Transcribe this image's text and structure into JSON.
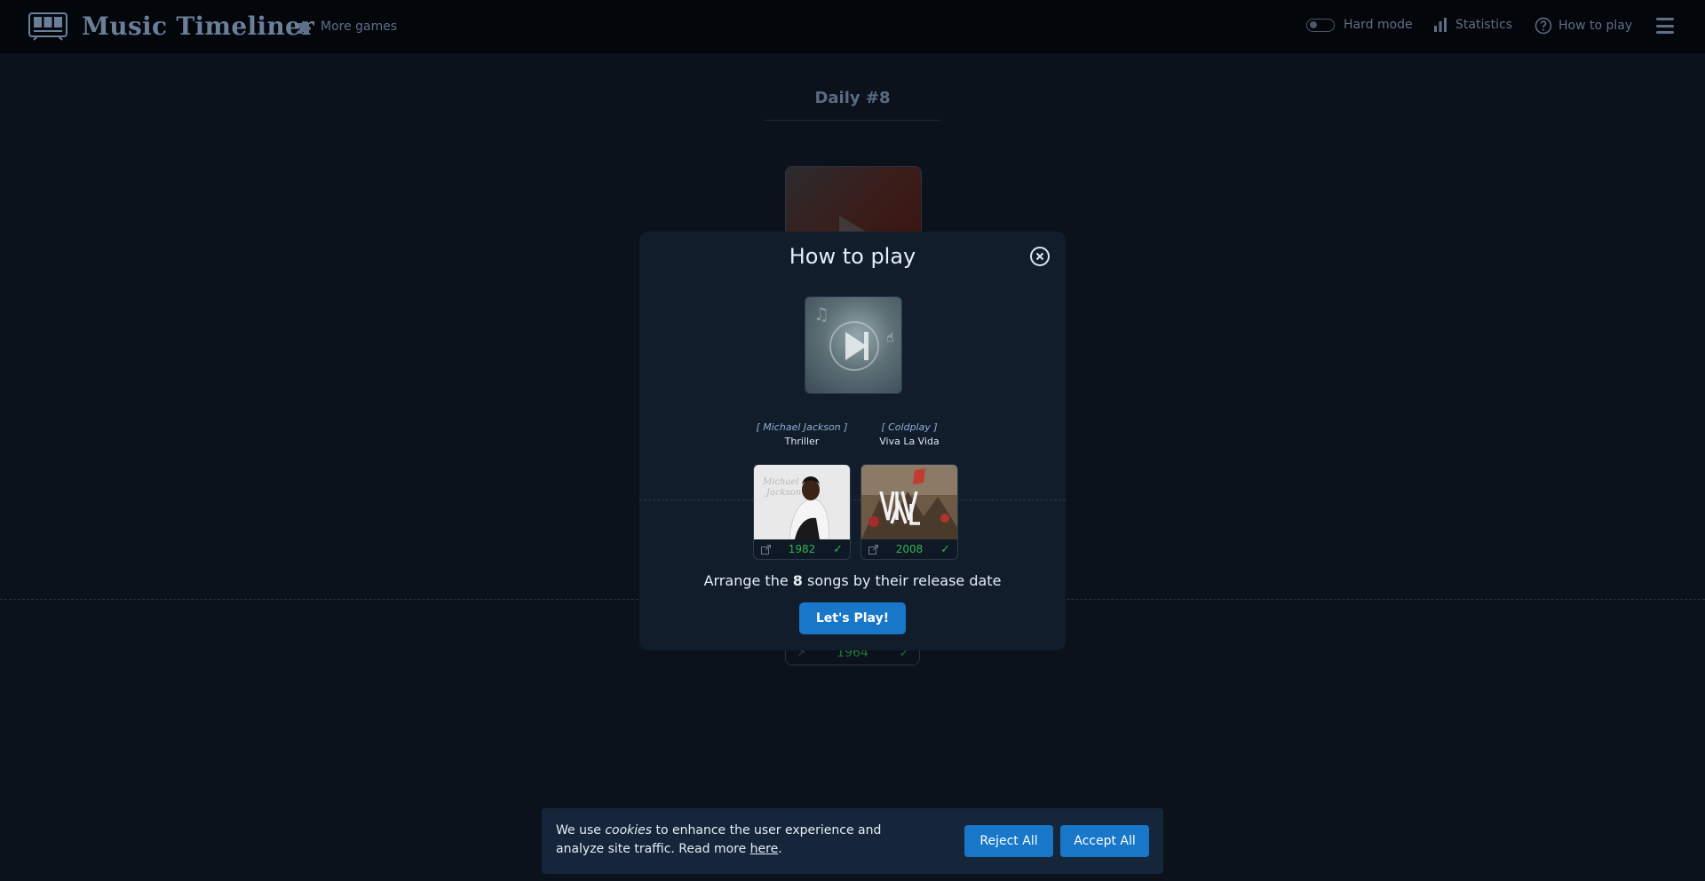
{
  "header": {
    "app_title": "Music Timeliner",
    "more_games": "More games",
    "hard_mode": "Hard mode",
    "statistics": "Statistics",
    "how_to_play": "How to play",
    "icons": {
      "logo": "app-logo-icon",
      "puzzle": "puzzle-icon",
      "chart": "bar-chart-icon",
      "help": "help-circle-icon",
      "menu": "hamburger-icon"
    }
  },
  "background": {
    "daily_label": "Daily #8",
    "year": "1964"
  },
  "modal": {
    "title": "How to play",
    "songs": [
      {
        "artist": "[ Michael Jackson ]",
        "title": "Thriller",
        "year": "1982"
      },
      {
        "artist": "[ Coldplay ]",
        "title": "Viva La Vida",
        "year": "2008"
      }
    ],
    "instructions_pre": "Arrange the ",
    "instructions_count": "8",
    "instructions_post": " songs by their release date",
    "cta": "Let's Play!"
  },
  "cookie": {
    "text_pre": "We use ",
    "text_em": "cookies",
    "text_mid": " to enhance the user experience and analyze site traffic. Read more ",
    "link": "here",
    "text_post": ".",
    "reject": "Reject All",
    "accept": "Accept All"
  },
  "colors": {
    "accent": "#1877c9",
    "correct": "#2fb350",
    "modal_bg": "#121d2b",
    "page_bg": "#0b121c"
  }
}
